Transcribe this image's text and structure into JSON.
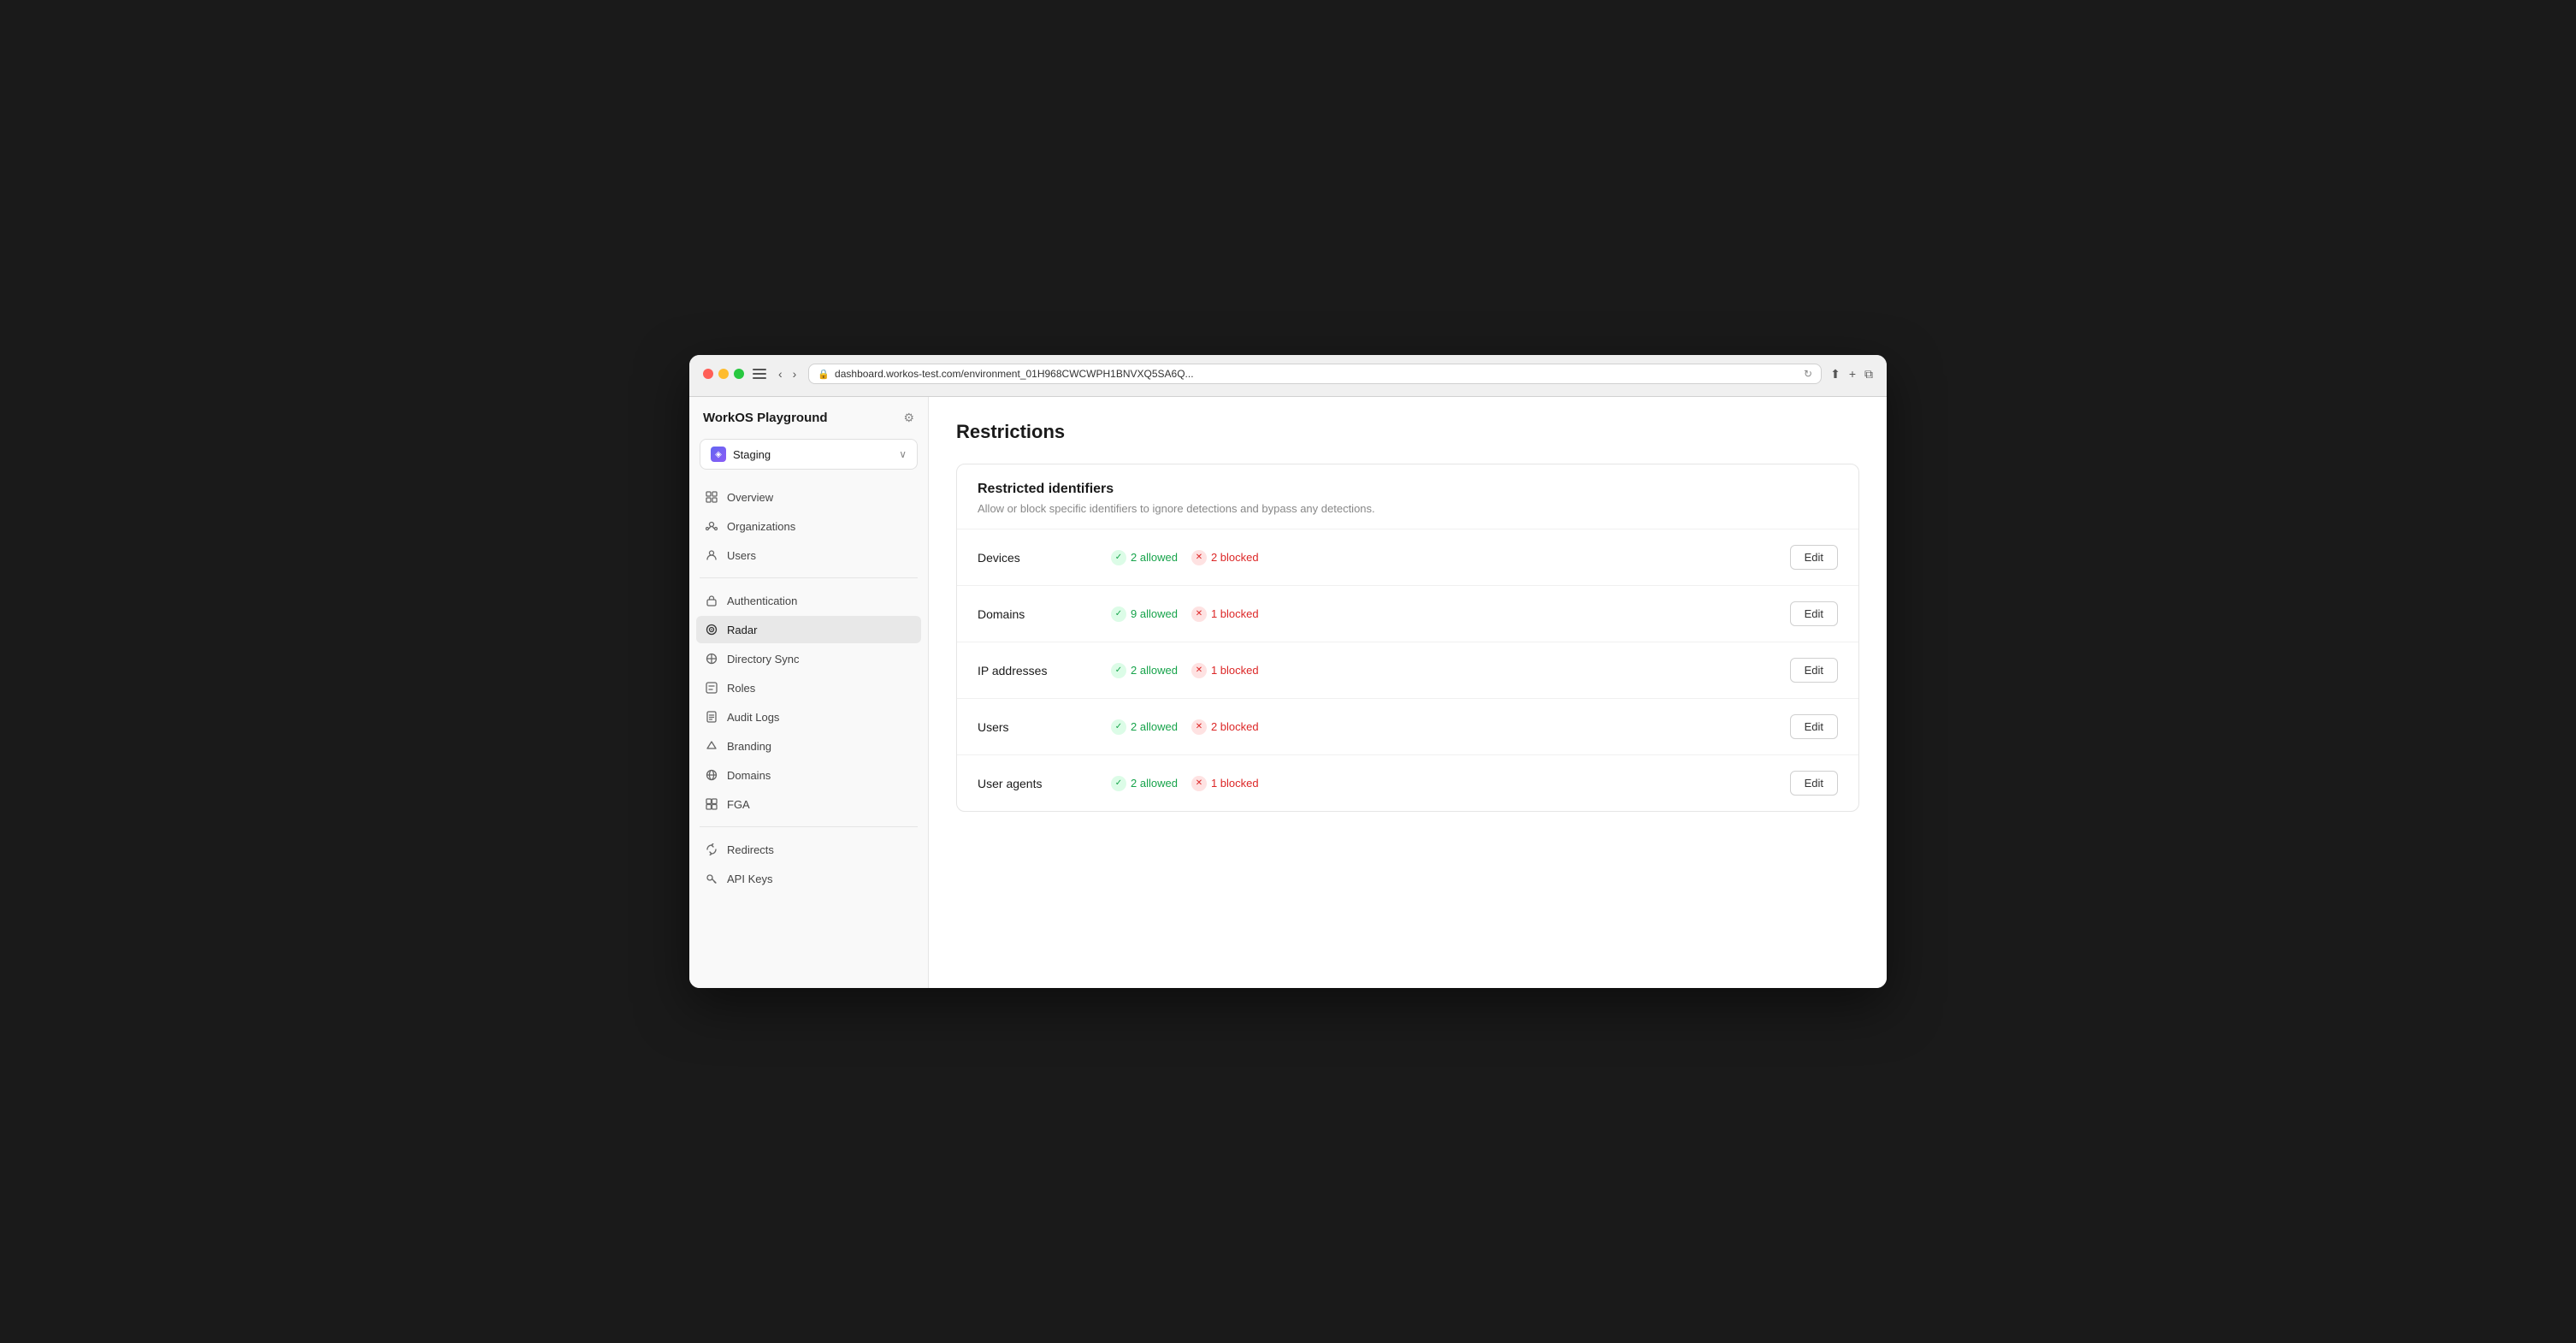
{
  "browser": {
    "url": "dashboard.workos-test.com/environment_01H968CWCWPH1BNVXQ5SA6Q...",
    "back_btn": "‹",
    "forward_btn": "›"
  },
  "sidebar": {
    "title": "WorkOS Playground",
    "env": {
      "name": "Staging",
      "icon": "◈"
    },
    "nav": [
      {
        "id": "overview",
        "label": "Overview",
        "icon": "⊞"
      },
      {
        "id": "organizations",
        "label": "Organizations",
        "icon": "◎"
      },
      {
        "id": "users",
        "label": "Users",
        "icon": "○"
      },
      {
        "id": "authentication",
        "label": "Authentication",
        "icon": "⊡"
      },
      {
        "id": "radar",
        "label": "Radar",
        "icon": "◉",
        "active": true
      },
      {
        "id": "directory-sync",
        "label": "Directory Sync",
        "icon": "⊙"
      },
      {
        "id": "roles",
        "label": "Roles",
        "icon": "⊟"
      },
      {
        "id": "audit-logs",
        "label": "Audit Logs",
        "icon": "⊠"
      },
      {
        "id": "branding",
        "label": "Branding",
        "icon": "⊡"
      },
      {
        "id": "domains",
        "label": "Domains",
        "icon": "⊕"
      },
      {
        "id": "fga",
        "label": "FGA",
        "icon": "⊞"
      }
    ],
    "nav2": [
      {
        "id": "redirects",
        "label": "Redirects",
        "icon": "⌗"
      },
      {
        "id": "api-keys",
        "label": "API Keys",
        "icon": "⌘"
      }
    ]
  },
  "page": {
    "title": "Restrictions",
    "card": {
      "title": "Restricted identifiers",
      "description": "Allow or block specific identifiers to ignore detections and bypass any detections.",
      "rows": [
        {
          "label": "Devices",
          "allowed_count": "2 allowed",
          "blocked_count": "2 blocked",
          "edit_label": "Edit"
        },
        {
          "label": "Domains",
          "allowed_count": "9 allowed",
          "blocked_count": "1 blocked",
          "edit_label": "Edit"
        },
        {
          "label": "IP addresses",
          "allowed_count": "2 allowed",
          "blocked_count": "1 blocked",
          "edit_label": "Edit"
        },
        {
          "label": "Users",
          "allowed_count": "2 allowed",
          "blocked_count": "2 blocked",
          "edit_label": "Edit"
        },
        {
          "label": "User agents",
          "allowed_count": "2 allowed",
          "blocked_count": "1 blocked",
          "edit_label": "Edit"
        }
      ]
    }
  }
}
